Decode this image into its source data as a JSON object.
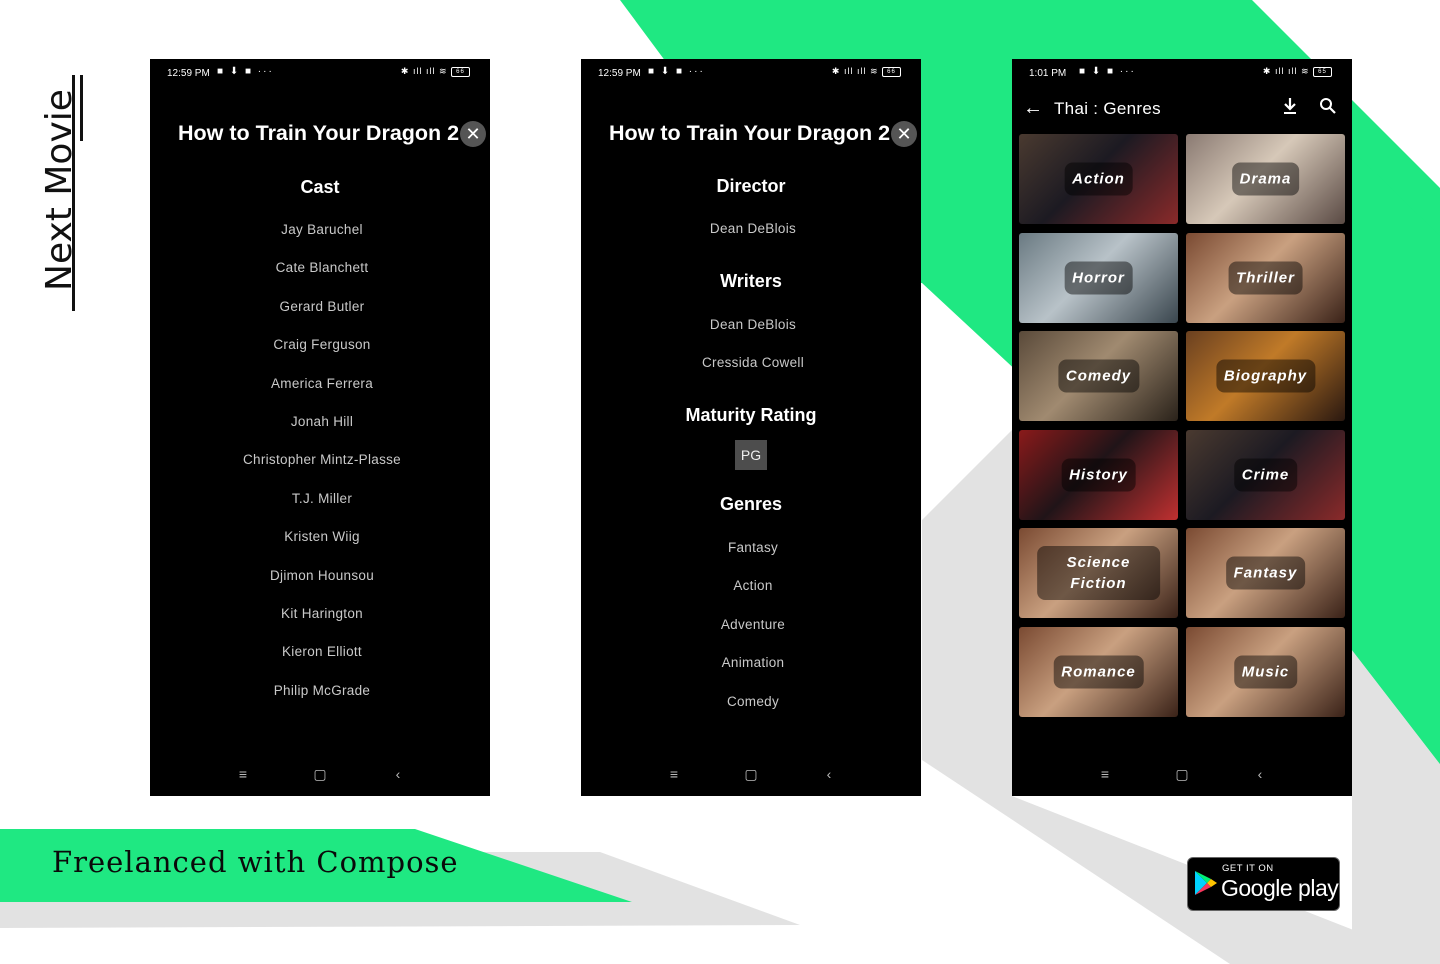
{
  "colors": {
    "accent": "#1fe882",
    "gray": "#e2e2e2"
  },
  "brand": {
    "name": "Next Movie"
  },
  "tagline": "Freelanced with Compose",
  "store_badge": {
    "top": "GET IT ON",
    "name": "Google play"
  },
  "phone_cast": {
    "status": {
      "time": "12:59 PM",
      "battery": "66"
    },
    "title": "How to Train Your Dragon 2",
    "section": "Cast",
    "cast": [
      "Jay Baruchel",
      "Cate Blanchett",
      "Gerard Butler",
      "Craig Ferguson",
      "America Ferrera",
      "Jonah Hill",
      "Christopher Mintz-Plasse",
      "T.J. Miller",
      "Kristen Wiig",
      "Djimon Hounsou",
      "Kit Harington",
      "Kieron Elliott",
      "Philip McGrade"
    ]
  },
  "phone_details": {
    "status": {
      "time": "12:59 PM",
      "battery": "66"
    },
    "title": "How to Train Your Dragon 2",
    "director_title": "Director",
    "director": "Dean DeBlois",
    "writers_title": "Writers",
    "writers": [
      "Dean DeBlois",
      "Cressida Cowell"
    ],
    "rating_title": "Maturity Rating",
    "rating": "PG",
    "genres_title": "Genres",
    "genres": [
      "Fantasy",
      "Action",
      "Adventure",
      "Animation",
      "Comedy"
    ]
  },
  "phone_genres": {
    "status": {
      "time": "1:01 PM",
      "battery": "65"
    },
    "title": "Thai : Genres",
    "tiles": [
      {
        "label": "Action"
      },
      {
        "label": "Drama"
      },
      {
        "label": "Horror"
      },
      {
        "label": "Thriller"
      },
      {
        "label": "Comedy"
      },
      {
        "label": "Biography"
      },
      {
        "label": "History"
      },
      {
        "label": "Crime"
      },
      {
        "label": "Science\nFiction"
      },
      {
        "label": "Fantasy"
      },
      {
        "label": "Romance"
      },
      {
        "label": "Music"
      }
    ]
  }
}
